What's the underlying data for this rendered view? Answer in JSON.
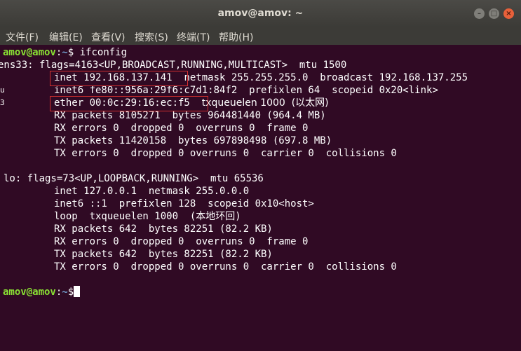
{
  "window": {
    "title": "amov@amov: ~",
    "controls": {
      "minimize": "–",
      "maximize": "□",
      "close": "×"
    }
  },
  "menu": {
    "items": [
      "文件(F)",
      "编辑(E)",
      "查看(V)",
      "搜索(S)",
      "终端(T)",
      "帮助(H)"
    ]
  },
  "prompt": {
    "user": "amov@amov",
    "sep": ":",
    "path": "~",
    "symbol": "$"
  },
  "terminal": {
    "command": " ifconfig",
    "ens33": {
      "header": "ens33: flags=4163<UP,BROADCAST,RUNNING,MULTICAST>  mtu 1500",
      "inet": "inet 192.168.137.141",
      "inet_rest": "netmask 255.255.255.0  broadcast 192.168.137.255",
      "inet6": "inet6 fe80::956a:29f6:c7d1:84f2  prefixlen 64  scopeid 0x20<link>",
      "ether": "ether 00:0c:29:16:ec:f5",
      "ether_rest": "txqueuelen 1000  (以太网)",
      "rx_packets": "RX packets 8105271  bytes 964481440 (964.4 MB)",
      "rx_errors": "RX errors 0  dropped 0  overruns 0  frame 0",
      "tx_packets": "TX packets 11420158  bytes 697898498 (697.8 MB)",
      "tx_errors": "TX errors 0  dropped 0 overruns 0  carrier 0  collisions 0"
    },
    "lo": {
      "header": "lo: flags=73<UP,LOOPBACK,RUNNING>  mtu 65536",
      "inet": "inet 127.0.0.1  netmask 255.0.0.0",
      "inet6": "inet6 ::1  prefixlen 128  scopeid 0x10<host>",
      "loop": "loop  txqueuelen 1000  (本地环回)",
      "rx_packets": "RX packets 642  bytes 82251 (82.2 KB)",
      "rx_errors": "RX errors 0  dropped 0  overruns 0  frame 0",
      "tx_packets": "TX packets 642  bytes 82251 (82.2 KB)",
      "tx_errors": "TX errors 0  dropped 0 overruns 0  carrier 0  collisions 0"
    },
    "left_edge_marks": [
      "u",
      "3"
    ]
  },
  "colors": {
    "background": "#300a24",
    "prompt_user": "#8ae234",
    "prompt_path": "#729fcf",
    "highlight_box": "#d22f2f",
    "close_button": "#e8603a"
  }
}
